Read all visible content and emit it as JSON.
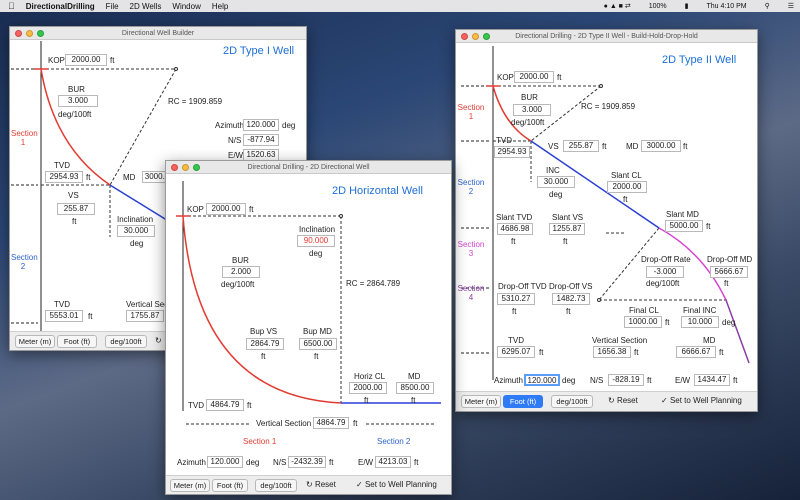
{
  "menubar": {
    "apple": "",
    "app": "DirectionalDrilling",
    "items": [
      "File",
      "2D Wells",
      "Window",
      "Help"
    ],
    "battery": "100%",
    "clock": "Thu 4:10 PM"
  },
  "w1": {
    "title": "Directional Well Builder",
    "heading": "2D Type I Well",
    "kop_label": "KOP",
    "kop": "2000.00",
    "ft": "ft",
    "bur_label": "BUR",
    "bur": "3.000",
    "deg100": "deg/100ft",
    "rc": "RC = 1909.859",
    "azimuth_label": "Azimuth",
    "azimuth": "120.000",
    "deg": "deg",
    "ns_label": "N/S",
    "ns": "-877.94",
    "ew_label": "E/W",
    "ew": "1520.63",
    "section1": "Section",
    "section1n": "1",
    "section2": "Section",
    "section2n": "2",
    "tvd_label": "TVD",
    "tvd": "2954.93",
    "md_label": "MD",
    "md": "3000.0",
    "vs_label": "VS",
    "vs": "255.87",
    "incl_label": "Inclination",
    "incl": "30.000",
    "tvd2_label": "TVD",
    "tvd2": "5553.01",
    "vsec_label": "Vertical Sec",
    "vsec": "1755.87",
    "meter": "Meter (m)",
    "foot": "Foot (ft)",
    "unit": "deg/100ft"
  },
  "w2": {
    "title": "Directional Drilling - 2D Directional Well",
    "heading": "2D Horizontal Well",
    "kop_label": "KOP",
    "kop": "2000.00",
    "ft": "ft",
    "incl_label": "Inclination",
    "incl": "90.000",
    "deg": "deg",
    "bur_label": "BUR",
    "bur": "2.000",
    "deg100": "deg/100ft",
    "rc": "RC =  2864.789",
    "bupvs_label": "Bup VS",
    "bupvs": "2864.79",
    "bupmd_label": "Bup MD",
    "bupmd": "6500.00",
    "hcl_label": "Horiz CL",
    "hcl": "2000.00",
    "md_label": "MD",
    "md": "8500.00",
    "tvd_label": "TVD",
    "tvd": "4864.79",
    "vsec_label": "Vertical Section",
    "vsec": "4864.79",
    "section1": "Section 1",
    "section2": "Section 2",
    "azimuth_label": "Azimuth",
    "azimuth": "120.000",
    "ns_label": "N/S",
    "ns": "-2432.39",
    "ew_label": "E/W",
    "ew": "4213.03",
    "meter": "Meter (m)",
    "foot": "Foot (ft)",
    "unit": "deg/100ft",
    "reset": "Reset",
    "setplan": "Set to Well Planning"
  },
  "w3": {
    "title": "Directional Drilling - 2D Type II Well - Build-Hold-Drop-Hold",
    "heading": "2D Type II Well",
    "kop_label": "KOP",
    "kop": "2000.00",
    "ft": "ft",
    "bur_label": "BUR",
    "bur": "3.000",
    "deg100": "deg/100ft",
    "rc": "RC = 1909.859",
    "tvd_label": "TVD",
    "tvd": "2954.93",
    "vs_label": "VS",
    "vs": "255.87",
    "md_label": "MD",
    "md": "3000.00",
    "inc_label": "INC",
    "inc": "30.000",
    "deg": "deg",
    "slantcl_label": "Slant CL",
    "slantcl": "2000.00",
    "slanttvd_label": "Slant TVD",
    "slanttvd": "4686.98",
    "slantvs_label": "Slant VS",
    "slantvs": "1255.87",
    "slantmd_label": "Slant MD",
    "slantmd": "5000.00",
    "dor_label": "Drop-Off Rate",
    "dor": "-3.000",
    "domd_label": "Drop-Off MD",
    "domd": "5666.67",
    "dotvd_label": "Drop-Off TVD",
    "dotvd": "5310.27",
    "dovs_label": "Drop-Off VS",
    "dovs": "1482.73",
    "fcl_label": "Final CL",
    "fcl": "1000.00",
    "finc_label": "Final INC",
    "finc": "10.000",
    "tvd2_label": "TVD",
    "tvd2": "6295.07",
    "vsec_label": "Vertical Section",
    "vsec": "1656.38",
    "md2_label": "MD",
    "md2": "6666.67",
    "s1": "Section",
    "s1n": "1",
    "s2": "Section",
    "s2n": "2",
    "s3": "Section",
    "s3n": "3",
    "s4": "Section",
    "s4n": "4",
    "azimuth_label": "Azimuth",
    "azimuth": "120.000",
    "ns_label": "N/S",
    "ns": "-828.19",
    "ew_label": "E/W",
    "ew": "1434.47",
    "meter": "Meter (m)",
    "foot": "Foot (ft)",
    "unit": "deg/100ft",
    "reset": "Reset",
    "setplan": "Set to Well Planning"
  },
  "colors": {
    "section1": "#e23b32",
    "section2": "#2a63c9",
    "section3": "#d645d2",
    "section4": "#8a3ea3",
    "title": "#1d6fd6"
  }
}
